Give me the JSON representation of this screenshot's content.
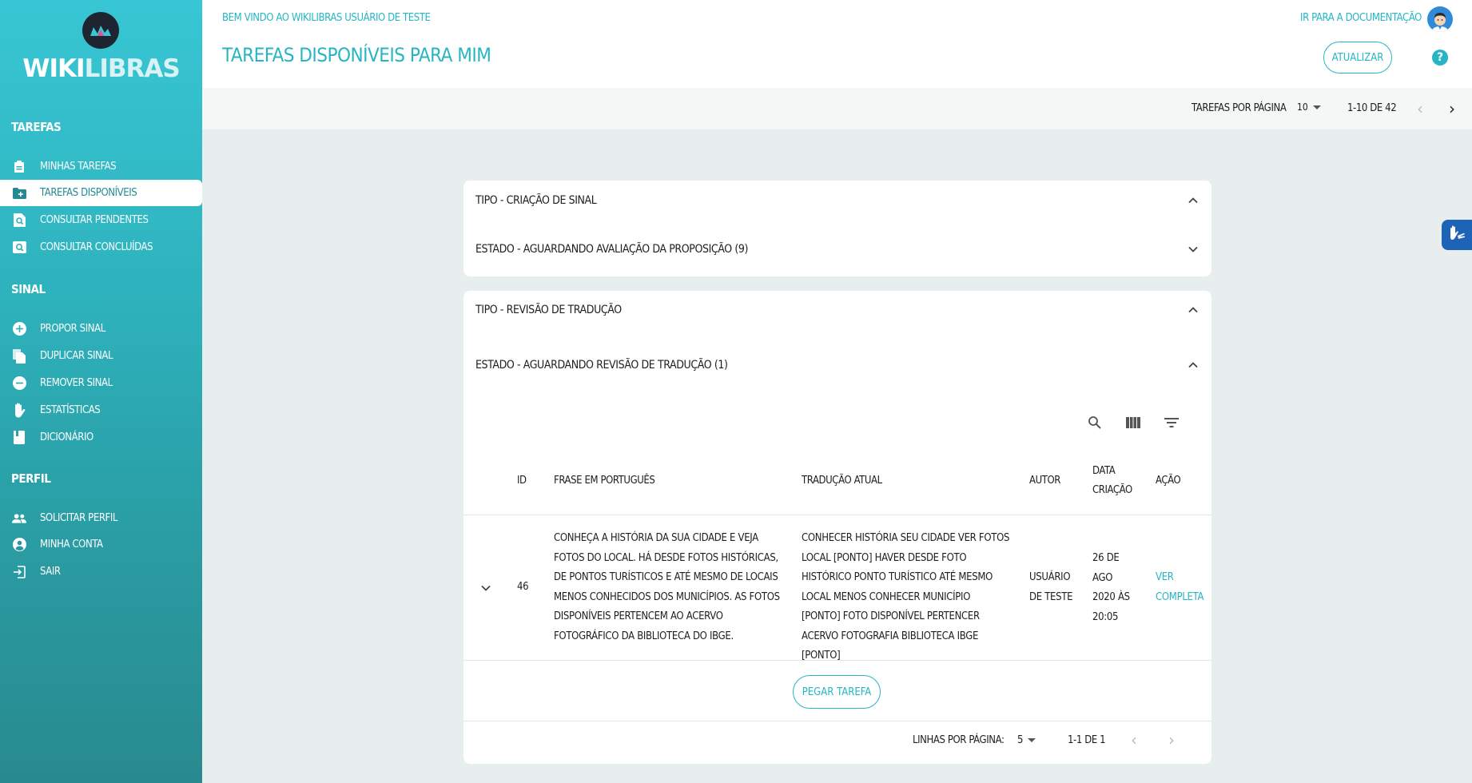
{
  "app": {
    "brand_first": "WIKI",
    "brand_second": "LIBRAS"
  },
  "sidebar": {
    "sections": [
      {
        "title": "Tarefas",
        "items": [
          {
            "label": "Minhas tarefas",
            "icon": "clipboard-icon"
          },
          {
            "label": "Tarefas disponíveis",
            "icon": "folder-plus-icon",
            "active": true
          },
          {
            "label": "Consultar pendentes",
            "icon": "search-doc-icon"
          },
          {
            "label": "Consultar concluídas",
            "icon": "search-image-icon"
          }
        ]
      },
      {
        "title": "Sinal",
        "items": [
          {
            "label": "Propor sinal",
            "icon": "add-circle-icon"
          },
          {
            "label": "Duplicar sinal",
            "icon": "copy-icon"
          },
          {
            "label": "Remover sinal",
            "icon": "remove-circle-icon"
          },
          {
            "label": "Estatísticas",
            "icon": "hand-icon"
          },
          {
            "label": "Dicionário",
            "icon": "book-icon"
          }
        ]
      },
      {
        "title": "Perfil",
        "items": [
          {
            "label": "Solicitar perfil",
            "icon": "people-icon"
          },
          {
            "label": "Minha conta",
            "icon": "account-circle-icon"
          },
          {
            "label": "Sair",
            "icon": "logout-icon"
          }
        ]
      }
    ]
  },
  "header": {
    "welcome": "Bem vindo ao WikiLibras Usuário de Teste",
    "title": "Tarefas disponíveis para mim",
    "doc_link": "Ir para a documentação",
    "refresh": "Atualizar",
    "help": "?"
  },
  "pager": {
    "label": "Tarefas por página",
    "per_page": "10",
    "range": "1-10 de 42"
  },
  "groups": {
    "g1_type": "Tipo - Criação de sinal",
    "g1_state": "Estado - Aguardando avaliação da proposição (9)",
    "g2_type": "Tipo - Revisão de tradução",
    "g2_state": "Estado - Aguardando revisão de tradução (1)"
  },
  "table": {
    "headers": {
      "id": "Id",
      "phrase": "Frase em português",
      "translation": "Tradução atual",
      "author": "Autor",
      "date": "Data criação",
      "action": "Ação"
    },
    "row": {
      "id": "46",
      "phrase": "Conheça a história da sua cidade e veja fotos do local. Há desde fotos históricas, de pontos turísticos e até mesmo de locais menos conhecidos dos municípios. As fotos disponíveis pertencem ao acervo fotográfico da biblioteca do IBGE.",
      "translation": "CONHECER HISTÓRIA SEU CIDADE VER FOTOS LOCAL [PONTO] HAVER DESDE FOTO HISTÓRICO PONTO TURÍSTICO ATÉ MESMO LOCAL MENOS CONHECER MUNICÍPIO [PONTO] FOTO DISPONÍVEL PERTENCER ACERVO FOTOGRAFIA BIBLIOTECA IBGE [PONTO]",
      "author": "Usuário de Teste",
      "date": "26 de ago 2020 às 20:05",
      "action": "Ver completa"
    },
    "take_task": "Pegar tarefa",
    "rows_label": "Linhas por página:",
    "rows_per_page": "5",
    "rows_range": "1-1 de 1"
  },
  "colors": {
    "accent": "#27b5c3",
    "sidebar_top": "#38c6d4",
    "sidebar_bottom": "#288a8f"
  }
}
